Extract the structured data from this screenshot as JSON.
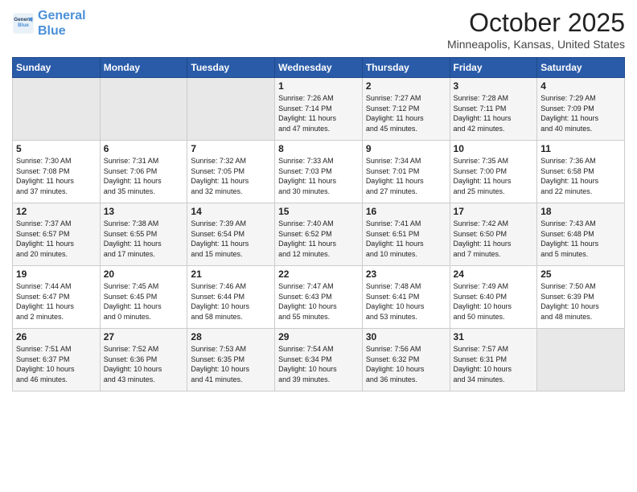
{
  "logo": {
    "line1": "General",
    "line2": "Blue"
  },
  "title": "October 2025",
  "location": "Minneapolis, Kansas, United States",
  "days_of_week": [
    "Sunday",
    "Monday",
    "Tuesday",
    "Wednesday",
    "Thursday",
    "Friday",
    "Saturday"
  ],
  "weeks": [
    [
      {
        "day": "",
        "info": ""
      },
      {
        "day": "",
        "info": ""
      },
      {
        "day": "",
        "info": ""
      },
      {
        "day": "1",
        "info": "Sunrise: 7:26 AM\nSunset: 7:14 PM\nDaylight: 11 hours\nand 47 minutes."
      },
      {
        "day": "2",
        "info": "Sunrise: 7:27 AM\nSunset: 7:12 PM\nDaylight: 11 hours\nand 45 minutes."
      },
      {
        "day": "3",
        "info": "Sunrise: 7:28 AM\nSunset: 7:11 PM\nDaylight: 11 hours\nand 42 minutes."
      },
      {
        "day": "4",
        "info": "Sunrise: 7:29 AM\nSunset: 7:09 PM\nDaylight: 11 hours\nand 40 minutes."
      }
    ],
    [
      {
        "day": "5",
        "info": "Sunrise: 7:30 AM\nSunset: 7:08 PM\nDaylight: 11 hours\nand 37 minutes."
      },
      {
        "day": "6",
        "info": "Sunrise: 7:31 AM\nSunset: 7:06 PM\nDaylight: 11 hours\nand 35 minutes."
      },
      {
        "day": "7",
        "info": "Sunrise: 7:32 AM\nSunset: 7:05 PM\nDaylight: 11 hours\nand 32 minutes."
      },
      {
        "day": "8",
        "info": "Sunrise: 7:33 AM\nSunset: 7:03 PM\nDaylight: 11 hours\nand 30 minutes."
      },
      {
        "day": "9",
        "info": "Sunrise: 7:34 AM\nSunset: 7:01 PM\nDaylight: 11 hours\nand 27 minutes."
      },
      {
        "day": "10",
        "info": "Sunrise: 7:35 AM\nSunset: 7:00 PM\nDaylight: 11 hours\nand 25 minutes."
      },
      {
        "day": "11",
        "info": "Sunrise: 7:36 AM\nSunset: 6:58 PM\nDaylight: 11 hours\nand 22 minutes."
      }
    ],
    [
      {
        "day": "12",
        "info": "Sunrise: 7:37 AM\nSunset: 6:57 PM\nDaylight: 11 hours\nand 20 minutes."
      },
      {
        "day": "13",
        "info": "Sunrise: 7:38 AM\nSunset: 6:55 PM\nDaylight: 11 hours\nand 17 minutes."
      },
      {
        "day": "14",
        "info": "Sunrise: 7:39 AM\nSunset: 6:54 PM\nDaylight: 11 hours\nand 15 minutes."
      },
      {
        "day": "15",
        "info": "Sunrise: 7:40 AM\nSunset: 6:52 PM\nDaylight: 11 hours\nand 12 minutes."
      },
      {
        "day": "16",
        "info": "Sunrise: 7:41 AM\nSunset: 6:51 PM\nDaylight: 11 hours\nand 10 minutes."
      },
      {
        "day": "17",
        "info": "Sunrise: 7:42 AM\nSunset: 6:50 PM\nDaylight: 11 hours\nand 7 minutes."
      },
      {
        "day": "18",
        "info": "Sunrise: 7:43 AM\nSunset: 6:48 PM\nDaylight: 11 hours\nand 5 minutes."
      }
    ],
    [
      {
        "day": "19",
        "info": "Sunrise: 7:44 AM\nSunset: 6:47 PM\nDaylight: 11 hours\nand 2 minutes."
      },
      {
        "day": "20",
        "info": "Sunrise: 7:45 AM\nSunset: 6:45 PM\nDaylight: 11 hours\nand 0 minutes."
      },
      {
        "day": "21",
        "info": "Sunrise: 7:46 AM\nSunset: 6:44 PM\nDaylight: 10 hours\nand 58 minutes."
      },
      {
        "day": "22",
        "info": "Sunrise: 7:47 AM\nSunset: 6:43 PM\nDaylight: 10 hours\nand 55 minutes."
      },
      {
        "day": "23",
        "info": "Sunrise: 7:48 AM\nSunset: 6:41 PM\nDaylight: 10 hours\nand 53 minutes."
      },
      {
        "day": "24",
        "info": "Sunrise: 7:49 AM\nSunset: 6:40 PM\nDaylight: 10 hours\nand 50 minutes."
      },
      {
        "day": "25",
        "info": "Sunrise: 7:50 AM\nSunset: 6:39 PM\nDaylight: 10 hours\nand 48 minutes."
      }
    ],
    [
      {
        "day": "26",
        "info": "Sunrise: 7:51 AM\nSunset: 6:37 PM\nDaylight: 10 hours\nand 46 minutes."
      },
      {
        "day": "27",
        "info": "Sunrise: 7:52 AM\nSunset: 6:36 PM\nDaylight: 10 hours\nand 43 minutes."
      },
      {
        "day": "28",
        "info": "Sunrise: 7:53 AM\nSunset: 6:35 PM\nDaylight: 10 hours\nand 41 minutes."
      },
      {
        "day": "29",
        "info": "Sunrise: 7:54 AM\nSunset: 6:34 PM\nDaylight: 10 hours\nand 39 minutes."
      },
      {
        "day": "30",
        "info": "Sunrise: 7:56 AM\nSunset: 6:32 PM\nDaylight: 10 hours\nand 36 minutes."
      },
      {
        "day": "31",
        "info": "Sunrise: 7:57 AM\nSunset: 6:31 PM\nDaylight: 10 hours\nand 34 minutes."
      },
      {
        "day": "",
        "info": ""
      }
    ]
  ]
}
